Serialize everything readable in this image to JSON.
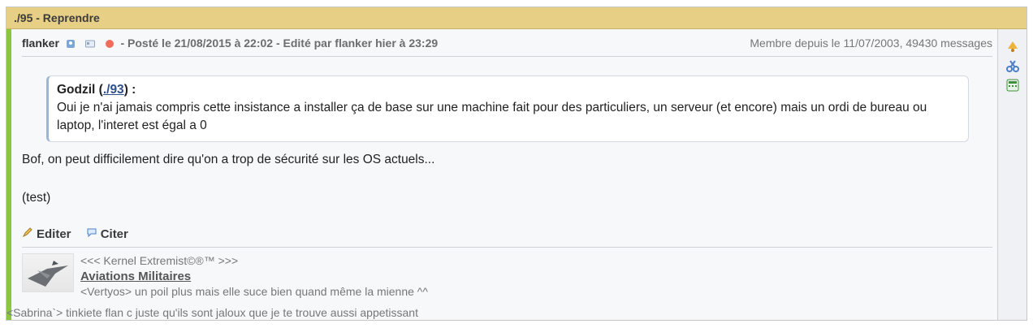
{
  "title": "./95 - Reprendre",
  "header": {
    "author": "flanker",
    "posted": "- Posté le 21/08/2015 à 22:02 - Edité par flanker hier à 23:29",
    "member_since": "Membre depuis le 11/07/2003, 49430 messages"
  },
  "quote": {
    "prefix": "Godzil (",
    "link_text": "./93",
    "suffix": ") :",
    "text": "Oui je n'ai jamais compris cette insistance a installer ça de base sur une machine fait pour des particuliers, un serveur (et encore) mais un ordi de bureau ou laptop, l'interet est égal a 0"
  },
  "body": {
    "line1": "Bof, on peut difficilement dire qu'on a trop de sécurité sur les OS actuels...",
    "line2": "(test)"
  },
  "actions": {
    "edit": "Editer",
    "quote": "Citer"
  },
  "signature": {
    "line1": "<<< Kernel Extremist©®™ >>>",
    "link": "Aviations Militaires",
    "line3": "<Vertyos> un poil plus mais elle suce bien quand même la mienne ^^",
    "line4": "<Sabrina`> tinkiete flan c juste qu'ils sont jaloux que je te trouve aussi appetissant"
  },
  "icons": {
    "sidebar": [
      "bell-icon",
      "scissors-icon",
      "calculator-icon"
    ],
    "header": [
      "user-icon",
      "id-card-icon",
      "status-icon"
    ]
  },
  "colors": {
    "titlebar": "#e8cf86",
    "leftbar": "#8cc63f",
    "link": "#2f4f8a"
  }
}
